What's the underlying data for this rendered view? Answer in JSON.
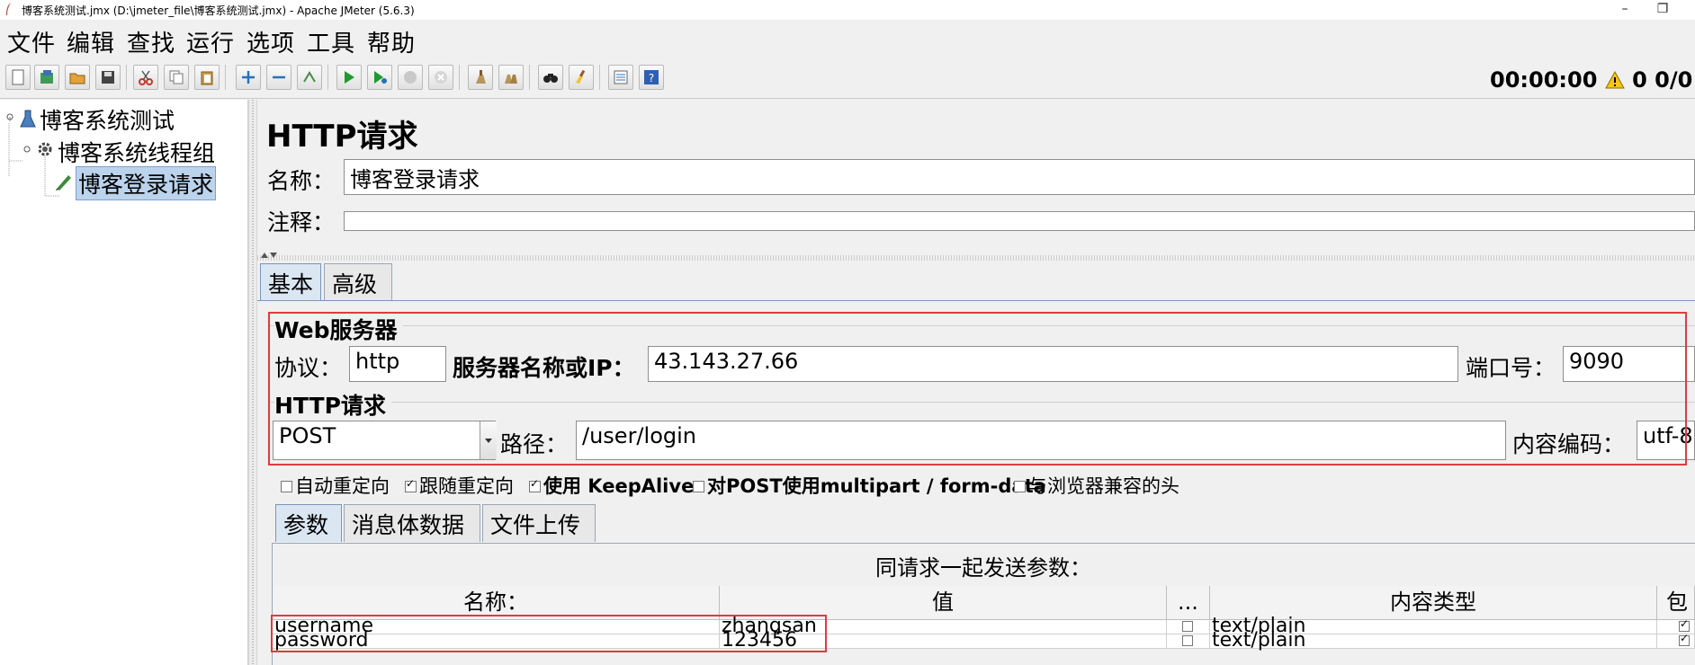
{
  "window": {
    "title": "博客系统测试.jmx (D:\\jmeter_file\\博客系统测试.jmx) - Apache JMeter (5.6.3)"
  },
  "menu": [
    "文件",
    "编辑",
    "查找",
    "运行",
    "选项",
    "工具",
    "帮助"
  ],
  "toolbar": {
    "buttons": [
      "new-icon",
      "templates-icon",
      "open-icon",
      "save-icon",
      "cut-icon",
      "copy-icon",
      "paste-icon",
      "expand-icon",
      "collapse-icon",
      "toggle-icon",
      "start-icon",
      "start-no-pause-icon",
      "stop-icon",
      "shutdown-icon",
      "clear-icon",
      "clear-all-icon",
      "search-icon",
      "reset-search-icon",
      "function-helper-icon",
      "help-icon"
    ],
    "timer": "00:00:00",
    "warnings": "0",
    "threads": "0/0"
  },
  "tree": {
    "root": "博客系统测试",
    "thread_group": "博客系统线程组",
    "sampler": "博客登录请求"
  },
  "panel": {
    "title": "HTTP请求",
    "name_label": "名称：",
    "name_value": "博客登录请求",
    "comment_label": "注释：",
    "comment_value": ""
  },
  "tabs": {
    "basic": "基本",
    "advanced": "高级"
  },
  "web_server": {
    "section_title": "Web服务器",
    "protocol_label": "协议：",
    "protocol_value": "http",
    "server_label": "服务器名称或IP：",
    "server_value": "43.143.27.66",
    "port_label": "端口号：",
    "port_value": "9090"
  },
  "http_request": {
    "section_title": "HTTP请求",
    "method": "POST",
    "path_label": "路径：",
    "path_value": "/user/login",
    "encoding_label": "内容编码：",
    "encoding_value": "utf-8"
  },
  "options": [
    {
      "label": "自动重定向",
      "checked": false
    },
    {
      "label": "跟随重定向",
      "checked": true
    },
    {
      "label": "使用 KeepAlive",
      "checked": true
    },
    {
      "label": "对POST使用multipart / form-data",
      "checked": false
    },
    {
      "label": "与浏览器兼容的头",
      "checked": false
    }
  ],
  "subtabs": {
    "params": "参数",
    "body": "消息体数据",
    "files": "文件上传"
  },
  "params_table": {
    "caption": "同请求一起发送参数：",
    "headers": {
      "name": "名称：",
      "value": "值",
      "more": "...",
      "content_type": "内容类型",
      "include": "包"
    },
    "rows": [
      {
        "name": "username",
        "value": "zhangsan",
        "content_type": "text/plain"
      },
      {
        "name": "password",
        "value": "123456",
        "content_type": "text/plain"
      }
    ]
  }
}
